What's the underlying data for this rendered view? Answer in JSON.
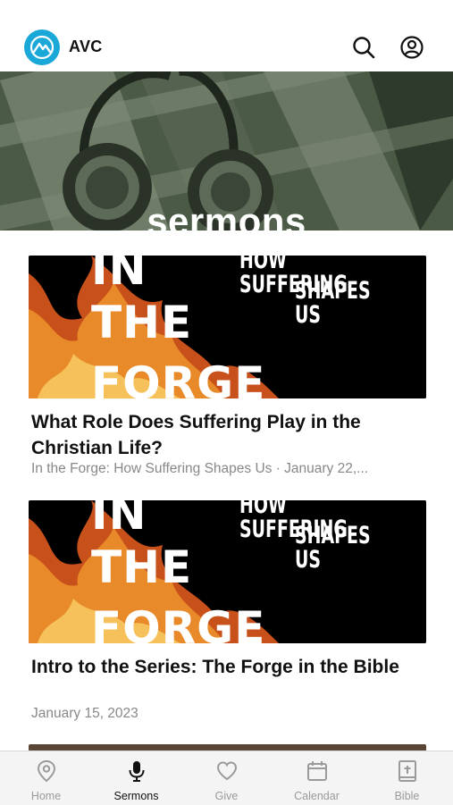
{
  "app": {
    "brand": "AVC"
  },
  "hero": {
    "title": "sermons"
  },
  "sermons": [
    {
      "art_title_lines": [
        "IN",
        "THE",
        "FORGE"
      ],
      "art_subtitle_lines": [
        "HOW SUFFERING",
        "SHAPES US"
      ],
      "title": "What Role Does Suffering Play in the Christian Life?",
      "meta": "In the Forge: How Suffering Shapes Us · January 22,..."
    },
    {
      "art_title_lines": [
        "IN",
        "THE",
        "FORGE"
      ],
      "art_subtitle_lines": [
        "HOW SUFFERING",
        "SHAPES US"
      ],
      "title": "Intro to the Series: The Forge in the Bible",
      "meta": "January 15, 2023"
    }
  ],
  "tabs": [
    {
      "label": "Home",
      "icon": "location-pin-icon",
      "active": false
    },
    {
      "label": "Sermons",
      "icon": "microphone-icon",
      "active": true
    },
    {
      "label": "Give",
      "icon": "heart-icon",
      "active": false
    },
    {
      "label": "Calendar",
      "icon": "calendar-icon",
      "active": false
    },
    {
      "label": "Bible",
      "icon": "bible-icon",
      "active": false
    }
  ],
  "colors": {
    "logo": "#1aa8d8",
    "hero_tint": "#3a4a36",
    "active_tab": "#111111",
    "inactive_tab": "#9a9a9a"
  }
}
